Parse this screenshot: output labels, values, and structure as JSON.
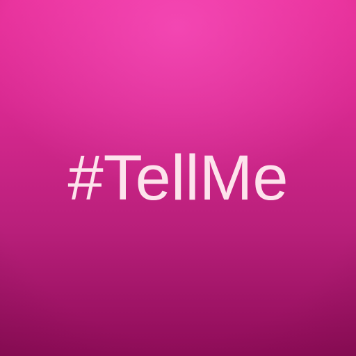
{
  "app": {
    "title": "#TellMe"
  },
  "colors": {
    "background_top": "#e8309a",
    "background_bottom": "#8e0c58",
    "text": "#fde3ec"
  }
}
